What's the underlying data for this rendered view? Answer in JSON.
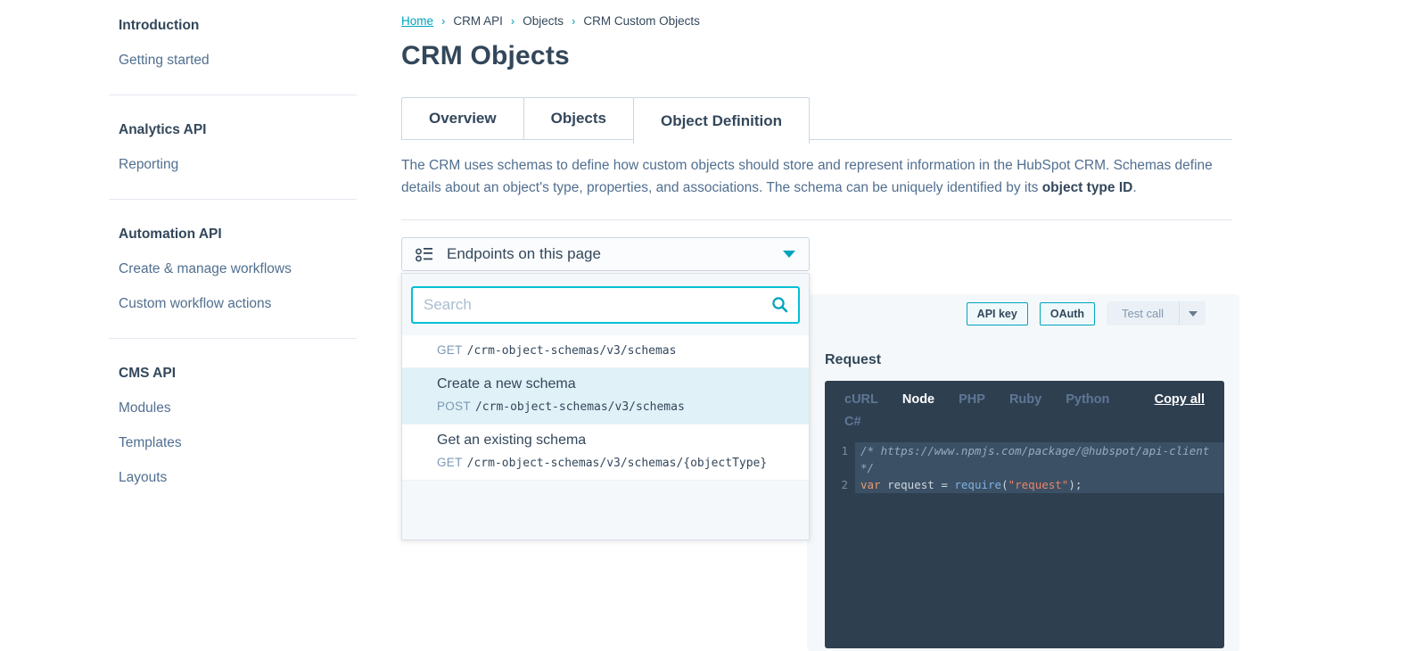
{
  "colors": {
    "accent": "#00a4bd",
    "heading_text": "#33475b",
    "body_text": "#516f90",
    "highlight_row": "#e0f2f7",
    "code_background": "#2e3f50",
    "panel_background": "#f5f8fa"
  },
  "sidebar": {
    "sections": [
      {
        "heading": "Introduction",
        "items": [
          "Getting started"
        ]
      },
      {
        "heading": "Analytics API",
        "items": [
          "Reporting"
        ]
      },
      {
        "heading": "Automation API",
        "items": [
          "Create & manage workflows",
          "Custom workflow actions"
        ]
      },
      {
        "heading": "CMS API",
        "items": [
          "Modules",
          "Templates",
          "Layouts"
        ]
      }
    ]
  },
  "breadcrumb": {
    "separator": "›",
    "items": [
      {
        "label": "Home",
        "link": true
      },
      {
        "label": "CRM API",
        "link": false
      },
      {
        "label": "Objects",
        "link": false
      },
      {
        "label": "CRM Custom Objects",
        "link": false
      }
    ]
  },
  "page": {
    "title": "CRM Objects"
  },
  "tabs": [
    {
      "label": "Overview",
      "active": false
    },
    {
      "label": "Objects",
      "active": false
    },
    {
      "label": "Object Definition",
      "active": true
    }
  ],
  "intro": {
    "text": "The CRM uses schemas to define how custom objects should store and represent information in the HubSpot CRM. Schemas define details about an object's type, properties, and associations. The schema can be uniquely identified by its ",
    "bold": "object type ID",
    "after": "."
  },
  "endpoints": {
    "toggle_label": "Endpoints on this page",
    "search_placeholder": "Search",
    "items": [
      {
        "title": "",
        "method": "GET",
        "path": "/crm-object-schemas/v3/schemas",
        "highlighted": false
      },
      {
        "title": "Create a new schema",
        "method": "POST",
        "path": "/crm-object-schemas/v3/schemas",
        "highlighted": true
      },
      {
        "title": "Get an existing schema",
        "method": "GET",
        "path": "/crm-object-schemas/v3/schemas/{objectType}",
        "highlighted": false
      }
    ]
  },
  "example_panel": {
    "auth_buttons": [
      "API key",
      "OAuth"
    ],
    "test_call_label": "Test call",
    "request_heading": "Request",
    "code": {
      "copy_all_label": "Copy all",
      "languages": [
        {
          "label": "cURL",
          "active": false
        },
        {
          "label": "Node",
          "active": true
        },
        {
          "label": "PHP",
          "active": false
        },
        {
          "label": "Ruby",
          "active": false
        },
        {
          "label": "Python",
          "active": false
        },
        {
          "label": "C#",
          "active": false
        }
      ],
      "lines": [
        {
          "number": "1",
          "segments": [
            {
              "text": "/* https://www.npmjs.com/package/@hubspot/api-client */",
              "type": "comment"
            }
          ]
        },
        {
          "number": "2",
          "segments": [
            {
              "text": "var",
              "type": "keyword"
            },
            {
              "text": " request ",
              "type": "plain"
            },
            {
              "text": "= ",
              "type": "plain"
            },
            {
              "text": "require",
              "type": "func"
            },
            {
              "text": "(",
              "type": "plain"
            },
            {
              "text": "\"request\"",
              "type": "string"
            },
            {
              "text": ");",
              "type": "plain"
            }
          ]
        }
      ]
    }
  }
}
